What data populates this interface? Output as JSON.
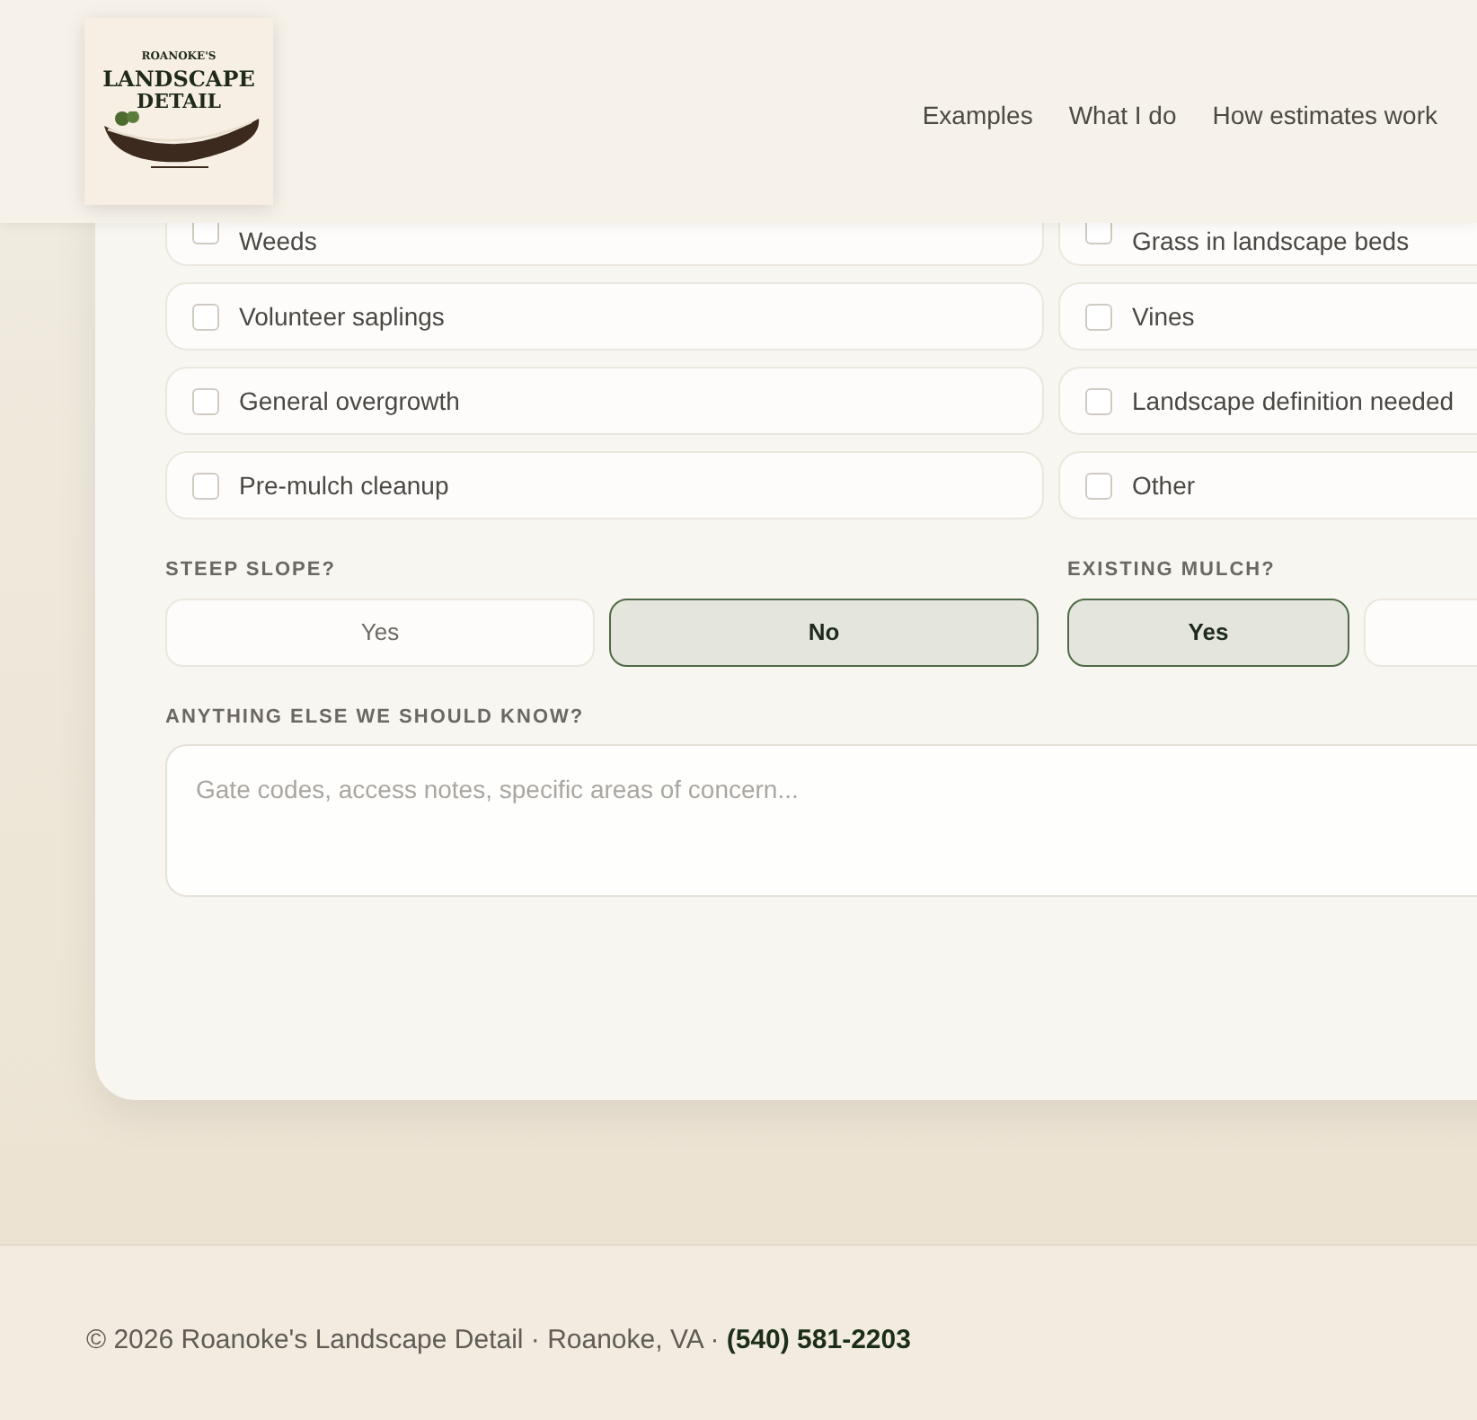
{
  "header": {
    "logo": {
      "top": "ROANOKE'S",
      "middle": "LANDSCAPE",
      "bottom": "DETAIL"
    },
    "nav": [
      {
        "label": "Examples"
      },
      {
        "label": "What I do"
      },
      {
        "label": "How estimates work"
      }
    ]
  },
  "issues": [
    {
      "label": "Weeds",
      "checked": false
    },
    {
      "label": "Grass in landscape beds",
      "checked": false
    },
    {
      "label": "Volunteer saplings",
      "checked": false
    },
    {
      "label": "Vines",
      "checked": false
    },
    {
      "label": "General overgrowth",
      "checked": false
    },
    {
      "label": "Landscape definition needed",
      "checked": false
    },
    {
      "label": "Pre-mulch cleanup",
      "checked": false
    },
    {
      "label": "Other",
      "checked": false
    }
  ],
  "steep_slope": {
    "label": "STEEP SLOPE?",
    "options": [
      {
        "label": "Yes",
        "selected": false
      },
      {
        "label": "No",
        "selected": true
      }
    ]
  },
  "existing_mulch": {
    "label": "EXISTING MULCH?",
    "options": [
      {
        "label": "Yes",
        "selected": true
      },
      {
        "selected": false
      }
    ]
  },
  "notes": {
    "label": "ANYTHING ELSE WE SHOULD KNOW?",
    "placeholder": "Gate codes, access notes, specific areas of concern..."
  },
  "footer": {
    "text": "© 2026 Roanoke's Landscape Detail · Roanoke, VA · ",
    "phone": "(540) 581-2203"
  }
}
